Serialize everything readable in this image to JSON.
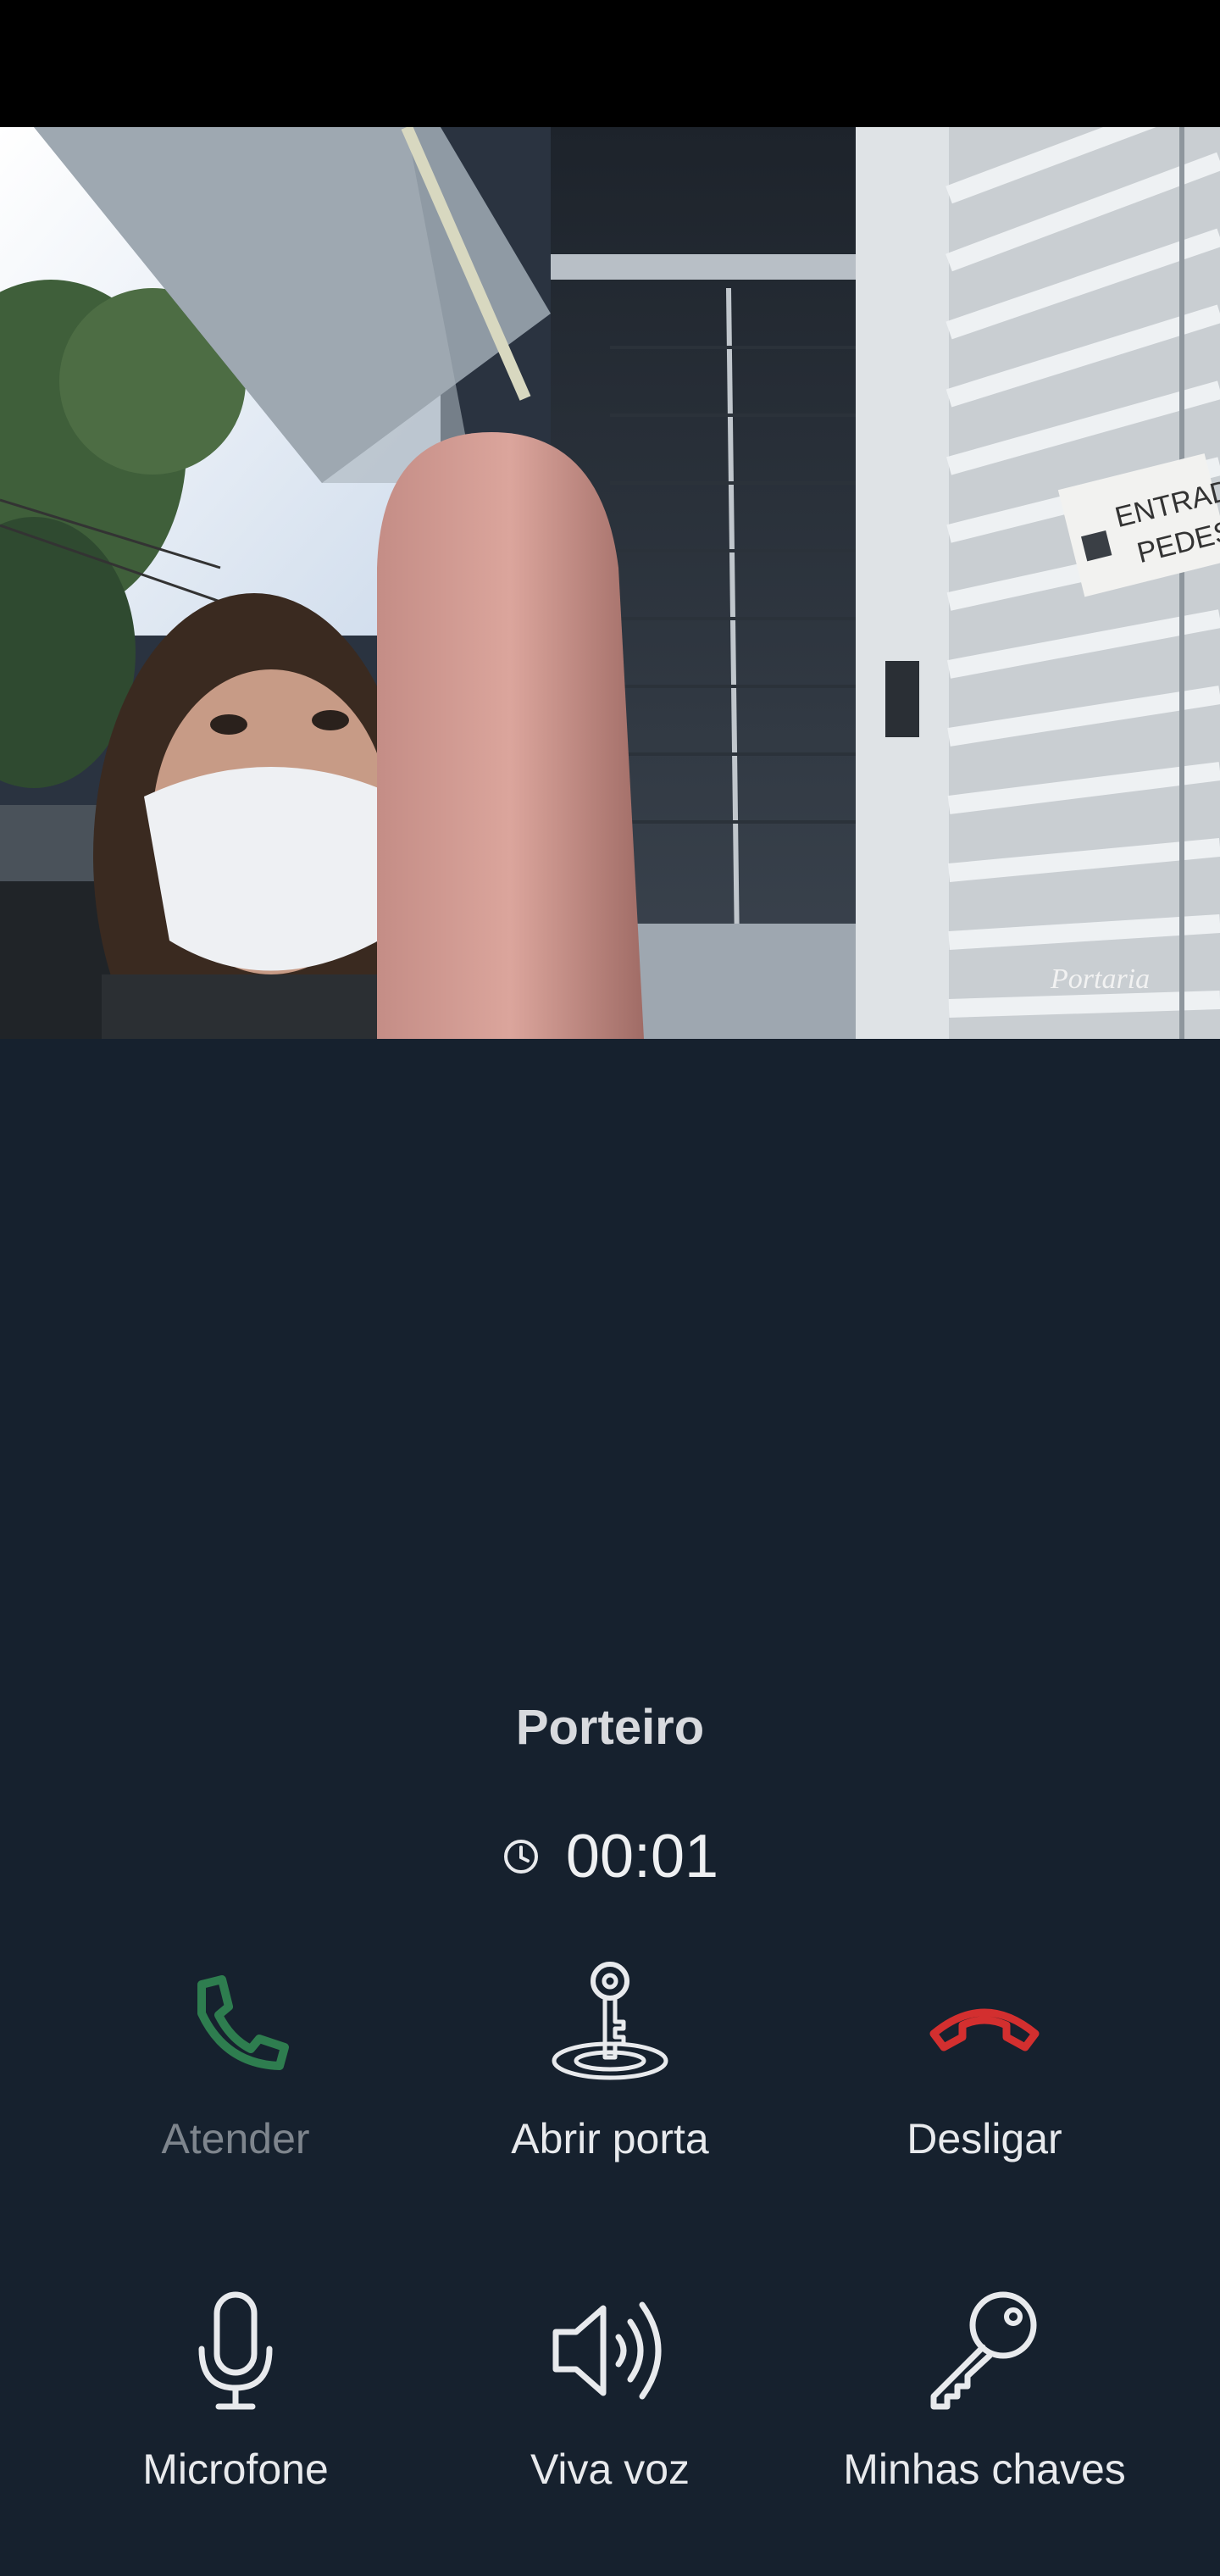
{
  "video": {
    "sign_line1": "ENTRADA",
    "sign_line2": "PEDESTR",
    "camera_label": "Portaria"
  },
  "call": {
    "caller_name": "Porteiro",
    "duration": "00:01"
  },
  "actions": {
    "answer": {
      "label": "Atender",
      "icon": "phone-icon",
      "color": "#2e7d4f",
      "enabled": false
    },
    "open_door": {
      "label": "Abrir porta",
      "icon": "door-key-icon"
    },
    "hang_up": {
      "label": "Desligar",
      "icon": "hang-up-icon",
      "color": "#d32f2f"
    },
    "microphone": {
      "label": "Microfone",
      "icon": "microphone-icon"
    },
    "speaker": {
      "label": "Viva voz",
      "icon": "speaker-icon"
    },
    "my_keys": {
      "label": "Minhas chaves",
      "icon": "key-icon"
    }
  },
  "colors": {
    "background": "#16212e",
    "text": "#e8eaed",
    "disabled_text": "#7e858d"
  }
}
